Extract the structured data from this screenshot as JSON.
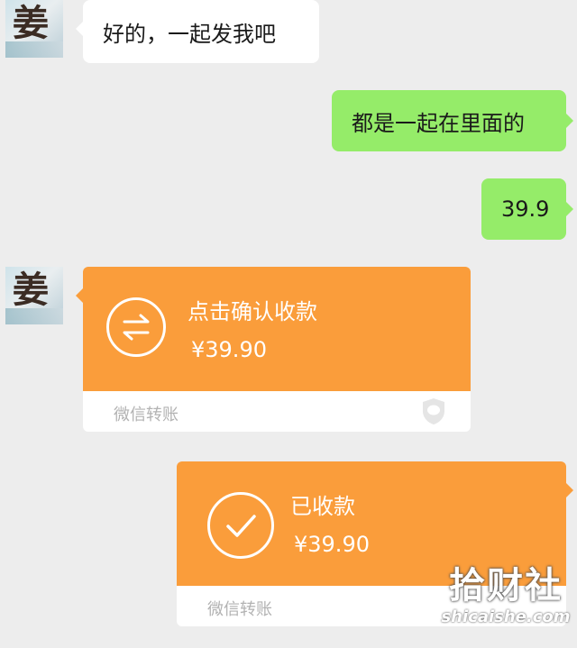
{
  "messages": [
    {
      "side": "left",
      "type": "text",
      "text": "好的，一起发我吧"
    },
    {
      "side": "right",
      "type": "text",
      "text": "都是一起在里面的"
    },
    {
      "side": "right",
      "type": "text",
      "text": "39.9"
    },
    {
      "side": "left",
      "type": "transfer",
      "title": "点击确认收款",
      "amount": "¥39.90",
      "source": "微信转账",
      "icon": "transfer-arrows-icon"
    },
    {
      "side": "right",
      "type": "transfer",
      "title": "已收款",
      "amount": "¥39.90",
      "source": "微信转账",
      "icon": "checkmark-icon"
    }
  ],
  "avatar": {
    "glyph": "姜"
  },
  "watermark": {
    "main": "拾财社",
    "sub": "shicaishe.com"
  },
  "colors": {
    "background": "#ededed",
    "left_bubble": "#ffffff",
    "right_bubble": "#95ec69",
    "transfer_orange": "#fa9d3b",
    "transfer_footer": "#ffffff",
    "footer_text": "#b2b2b2"
  }
}
